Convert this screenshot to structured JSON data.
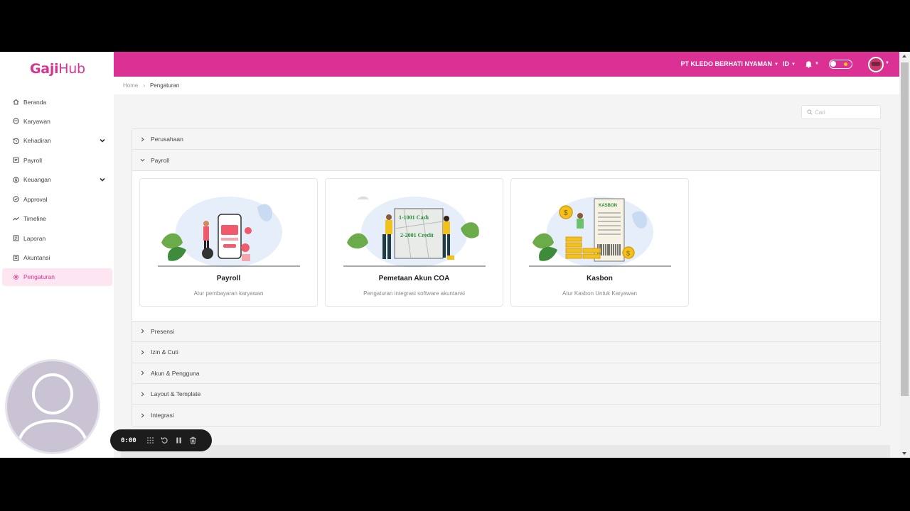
{
  "brand": {
    "logo_part1": "Gaji",
    "logo_part2": "Hub",
    "accent": "#db3195"
  },
  "sidebar": {
    "items": [
      {
        "label": "Beranda",
        "icon": "home-icon"
      },
      {
        "label": "Karyawan",
        "icon": "users-icon"
      },
      {
        "label": "Kehadiran",
        "icon": "history-icon",
        "expandable": true
      },
      {
        "label": "Payroll",
        "icon": "payroll-icon"
      },
      {
        "label": "Keuangan",
        "icon": "dollar-icon",
        "expandable": true
      },
      {
        "label": "Approval",
        "icon": "check-circle-icon"
      },
      {
        "label": "Timeline",
        "icon": "chart-line-icon"
      },
      {
        "label": "Laporan",
        "icon": "file-icon"
      },
      {
        "label": "Akuntansi",
        "icon": "book-icon"
      },
      {
        "label": "Pengaturan",
        "icon": "gear-icon",
        "active": true
      }
    ]
  },
  "header": {
    "company": "PT KLEDO BERHATI NYAMAN",
    "language": "ID"
  },
  "breadcrumb": {
    "home": "Home",
    "current": "Pengaturan"
  },
  "search": {
    "placeholder": "Cari"
  },
  "accordion": {
    "sections": [
      "Perusahaan",
      "Payroll",
      "Presensi",
      "Izin & Cuti",
      "Akun & Pengguna",
      "Layout & Template",
      "Integrasi"
    ],
    "expanded": "Payroll"
  },
  "cards": [
    {
      "title": "Payroll",
      "desc": "Atur pembayaran karyawan"
    },
    {
      "title": "Pemetaan Akun COA",
      "desc": "Pengaturan integrasi software akuntansi",
      "illus_line1": "1-1001  Cash",
      "illus_line2": "2-2001  Credit"
    },
    {
      "title": "Kasbon",
      "desc": "Atur Kasbon Untuk Karyawan",
      "illus_label": "KASBON"
    }
  ],
  "recorder": {
    "time": "0:00"
  }
}
